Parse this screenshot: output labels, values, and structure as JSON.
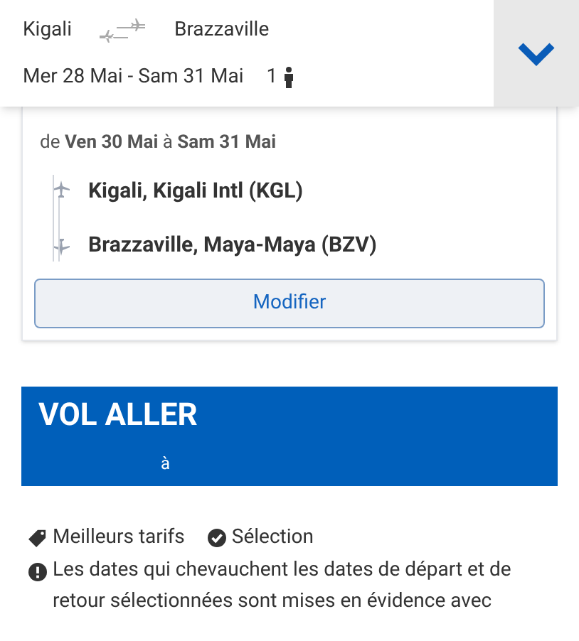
{
  "header": {
    "origin": "Kigali",
    "destination": "Brazzaville",
    "dates": "Mer 28 Mai - Sam 31 Mai",
    "passengers": "1"
  },
  "summary": {
    "range": "de **Ven 30 Mai** à **Sam 31 Mai**",
    "from": "Kigali, Kigali Intl (KGL)",
    "to": "Brazzaville, Maya-Maya (BZV)",
    "button": "Modifier"
  },
  "banner": {
    "title": "VOL ALLER",
    "subtitle": "à"
  },
  "legend": [
    {
      "kind": "tag",
      "label": "Meilleurs tarifs"
    },
    {
      "kind": "check",
      "label": "Sélection"
    }
  ],
  "note": "Les dates qui chevauchent les dates de départ et de retour sélectionnées sont mises en évidence avec"
}
